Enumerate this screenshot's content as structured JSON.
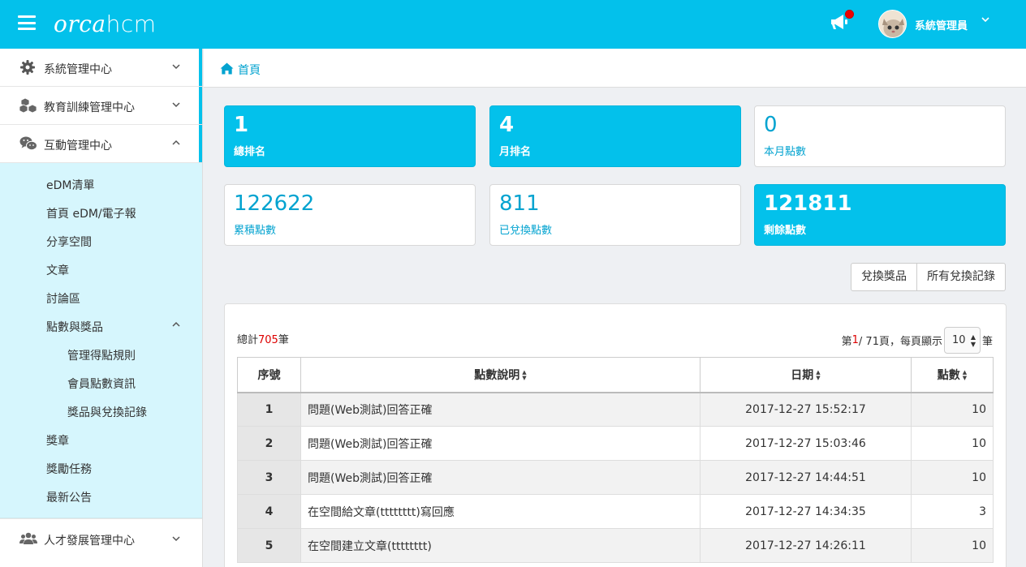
{
  "app": {
    "logo_orca": "orca",
    "logo_hcm": "hcm",
    "username": "系統管理員"
  },
  "colors": {
    "accent": "#03c1eb",
    "link": "#03a3d0",
    "highlight": "#d00000",
    "submenu_bg": "#d6f6fd"
  },
  "sidebar": {
    "top_items": [
      {
        "label": "系統管理中心",
        "icon": "gear-icon"
      },
      {
        "label": "教育訓練管理中心",
        "icon": "cubes-icon"
      },
      {
        "label": "互動管理中心",
        "icon": "wechat-icon"
      }
    ],
    "sub_items": [
      {
        "label": "eDM清單"
      },
      {
        "label": "首頁 eDM/電子報"
      },
      {
        "label": "分享空間"
      },
      {
        "label": "文章"
      },
      {
        "label": "討論區"
      },
      {
        "label": "點數與獎品"
      },
      {
        "label": "管理得點規則"
      },
      {
        "label": "會員點數資訊"
      },
      {
        "label": "獎品與兌換記錄"
      },
      {
        "label": "獎章"
      },
      {
        "label": "獎勵任務"
      },
      {
        "label": "最新公告"
      }
    ],
    "bottom_item": {
      "label": "人才發展管理中心",
      "icon": "users-icon"
    }
  },
  "breadcrumb": {
    "home": "首頁"
  },
  "stats": [
    {
      "value": "1",
      "label": "總排名"
    },
    {
      "value": "4",
      "label": "月排名"
    },
    {
      "value": "0",
      "label": "本月點數"
    },
    {
      "value": "122622",
      "label": "累積點數"
    },
    {
      "value": "811",
      "label": "已兌換點數"
    },
    {
      "value": "121811",
      "label": "剩餘點數"
    }
  ],
  "buttons": {
    "redeem": "兌換獎品",
    "all_records": "所有兌換記錄"
  },
  "summary": {
    "total_prefix": "總計",
    "total_count": "705",
    "total_suffix": "筆",
    "page_prefix": "第",
    "page_current": "1",
    "page_rest": "/ 71頁，每頁顯示",
    "per_page": "10",
    "per_page_suffix": "筆"
  },
  "table": {
    "headers": [
      "序號",
      "點數說明",
      "日期",
      "點數"
    ],
    "rows": [
      {
        "no": "1",
        "desc": "問題(Web測試)回答正確",
        "date": "2017-12-27 15:52:17",
        "points": "10"
      },
      {
        "no": "2",
        "desc": "問題(Web測試)回答正確",
        "date": "2017-12-27 15:03:46",
        "points": "10"
      },
      {
        "no": "3",
        "desc": "問題(Web測試)回答正確",
        "date": "2017-12-27 14:44:51",
        "points": "10"
      },
      {
        "no": "4",
        "desc": "在空間給文章(tttttttt)寫回應",
        "date": "2017-12-27 14:34:35",
        "points": "3"
      },
      {
        "no": "5",
        "desc": "在空間建立文章(tttttttt)",
        "date": "2017-12-27 14:26:11",
        "points": "10"
      }
    ]
  }
}
